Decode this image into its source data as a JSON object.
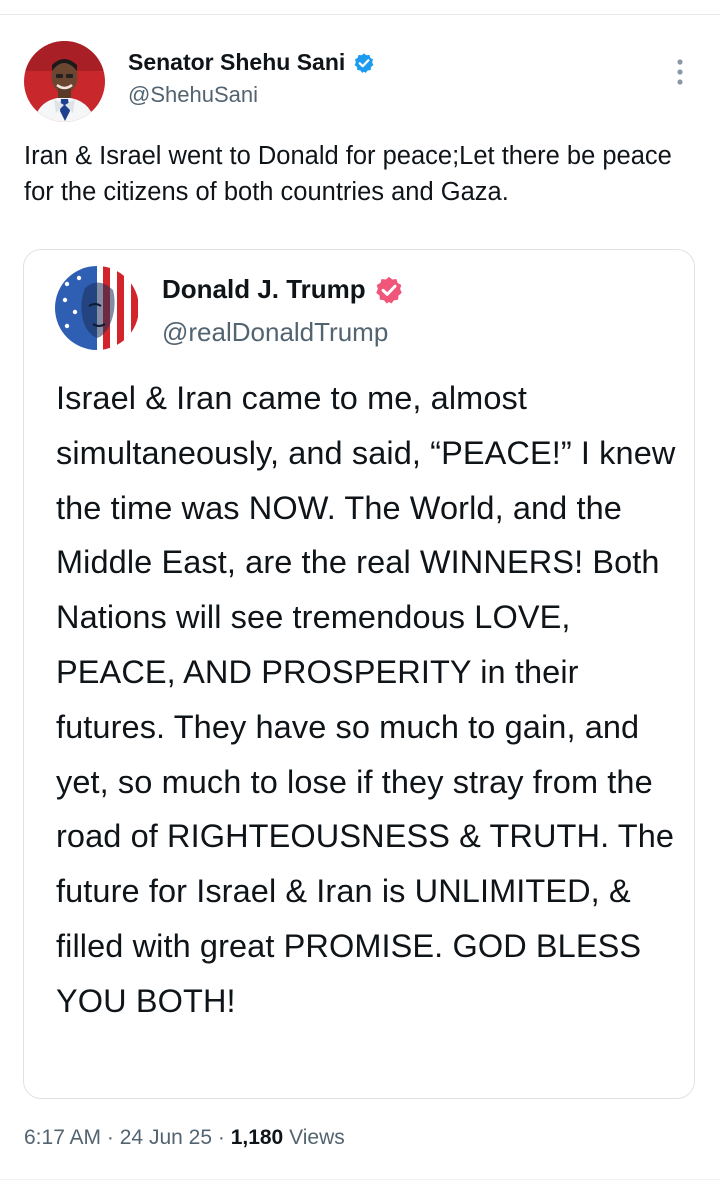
{
  "tweet": {
    "author": {
      "name": "Senator Shehu Sani",
      "handle": "@ShehuSani",
      "verified_color": "#1d9bf0"
    },
    "text": "Iran & Israel went to Donald for peace;Let there be peace for the citizens of both countries and Gaza.",
    "quoted": {
      "author": {
        "name": "Donald J. Trump",
        "handle": "@realDonaldTrump",
        "verified_color": "#f0567a"
      },
      "text": "Israel & Iran came to me, almost simultaneously, and said, “PEACE!” I knew the time was NOW. The World, and the Middle East, are the real WINNERS! Both Nations will see tremendous LOVE, PEACE, AND PROSPERITY in their futures. They have so much to gain, and yet, so much to lose if they stray from the road of RIGHTEOUSNESS & TRUTH. The future for Israel & Iran is UNLIMITED, & filled with great PROMISE. GOD BLESS YOU BOTH!"
    },
    "meta": {
      "time": "6:17 AM",
      "separator": "·",
      "date": "24 Jun 25",
      "views_count": "1,180",
      "views_label": "Views"
    },
    "icons": {
      "verified": "verified-badge-icon",
      "more": "more-options-icon"
    }
  }
}
